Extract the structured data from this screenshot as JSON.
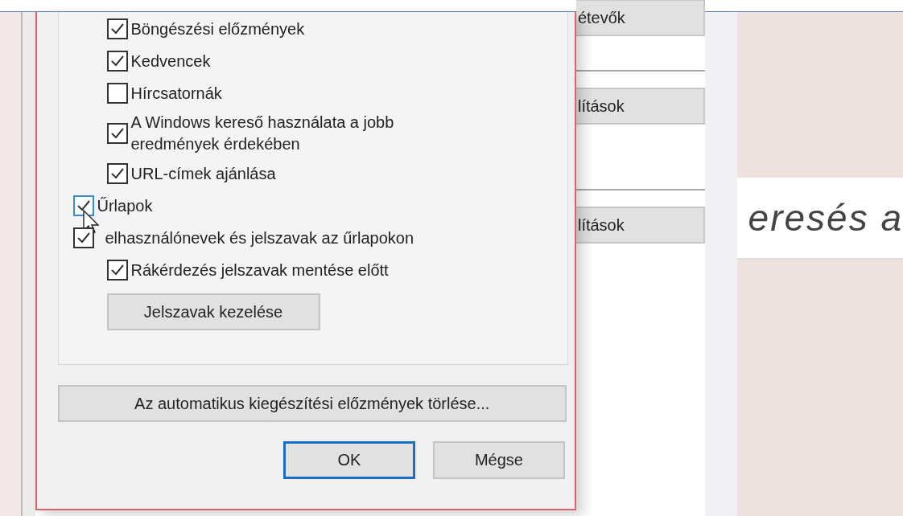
{
  "dialog": {
    "group": {
      "continued_options": [
        {
          "label": "Böngészési előzmények",
          "checked": true
        },
        {
          "label": "Kedvencek",
          "checked": true
        },
        {
          "label": "Hírcsatornák",
          "checked": false
        },
        {
          "label": "A Windows kereső használata a jobb eredmények érdekében",
          "checked": true
        },
        {
          "label": "URL-címek ajánlása",
          "checked": true
        }
      ],
      "options": [
        {
          "label": "Űrlapok",
          "checked": true,
          "focused": true
        },
        {
          "label": "elhasználónevek és jelszavak az űrlapokon",
          "checked": true,
          "children": [
            {
              "label": "Rákérdezés jelszavak mentése előtt",
              "checked": true
            }
          ]
        }
      ],
      "manage_button": "Jelszavak kezelése"
    },
    "clear_button": "Az automatikus kiegészítési előzmények törlése...",
    "buttons": [
      {
        "label": "OK",
        "default": true
      },
      {
        "label": "Mégse",
        "default": false
      }
    ]
  },
  "background": {
    "buttons": [
      "étevők",
      "lítások",
      "lítások"
    ],
    "page_text": "eresés a"
  }
}
